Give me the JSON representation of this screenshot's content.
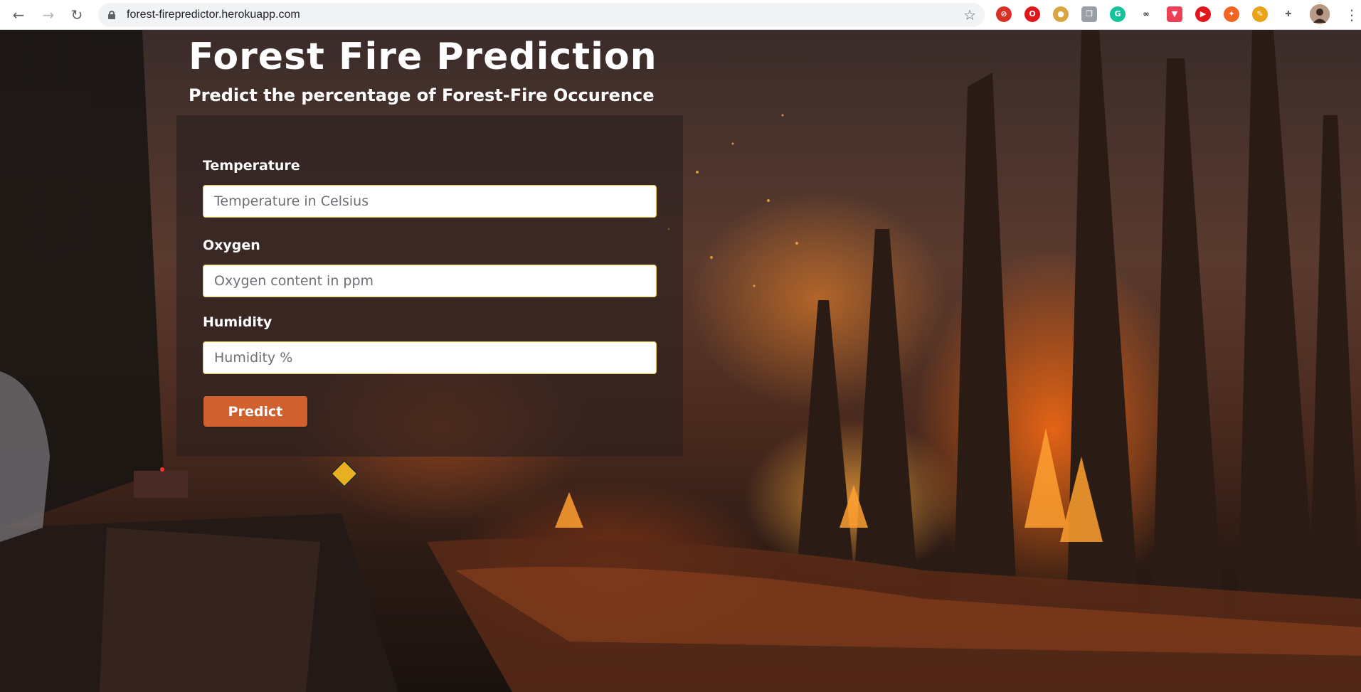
{
  "browser": {
    "url": "forest-firepredictor.herokuapp.com",
    "extensions": [
      {
        "name": "eye-slash-extension-icon",
        "glyph": "⊘",
        "color": "#d93025"
      },
      {
        "name": "opera-extension-icon",
        "glyph": "O",
        "color": "#e0161b"
      },
      {
        "name": "cookie-extension-icon",
        "glyph": "●",
        "color": "#d9a441"
      },
      {
        "name": "copy-extension-icon",
        "glyph": "❐",
        "color": "#9aa0a6"
      },
      {
        "name": "grammarly-extension-icon",
        "glyph": "G",
        "color": "#15c39a"
      },
      {
        "name": "link-extension-icon",
        "glyph": "∞",
        "color": "#202124"
      },
      {
        "name": "pocket-extension-icon",
        "glyph": "▼",
        "color": "#ef4056"
      },
      {
        "name": "youtube-extension-icon",
        "glyph": "▶",
        "color": "#e0161b"
      },
      {
        "name": "flame-extension-icon",
        "glyph": "✦",
        "color": "#f26522"
      },
      {
        "name": "translate-extension-icon",
        "glyph": "✎",
        "color": "#e8a317"
      },
      {
        "name": "puzzle-extensions-icon",
        "glyph": "✚",
        "color": "#5f6368"
      }
    ],
    "accent": "#d0602e"
  },
  "page": {
    "title": "Forest Fire Prediction",
    "subtitle": "Predict the percentage of Forest-Fire Occurence",
    "fields": [
      {
        "label": "Temperature",
        "placeholder": "Temperature in Celsius",
        "value": ""
      },
      {
        "label": "Oxygen",
        "placeholder": "Oxygen content in ppm",
        "value": ""
      },
      {
        "label": "Humidity",
        "placeholder": "Humidity %",
        "value": ""
      }
    ],
    "predict_label": "Predict"
  }
}
